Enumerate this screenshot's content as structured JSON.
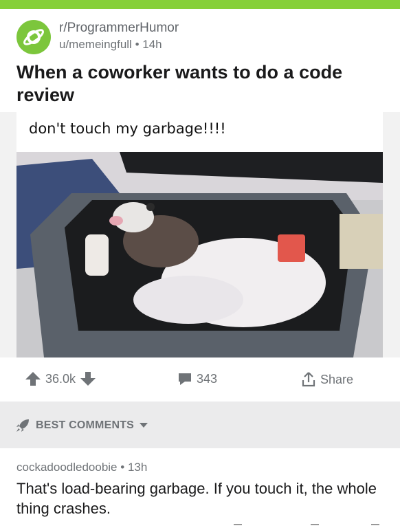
{
  "colors": {
    "accent": "#86d038",
    "avatar": "#7cc63c",
    "meta": "#6f7377"
  },
  "post": {
    "subreddit": "r/ProgrammerHumor",
    "author": "u/memeingfull",
    "time": "14h",
    "title": "When a coworker wants to do a code review",
    "image_caption": "don't touch my garbage!!!!",
    "upvotes": "36.0k",
    "comments": "343",
    "share_label": "Share"
  },
  "icons": [
    "subreddit-planet-icon",
    "upvote-arrow-icon",
    "downvote-arrow-icon",
    "comment-bubble-icon",
    "share-icon",
    "rocket-icon",
    "dropdown-caret-icon"
  ],
  "best_comments": {
    "label": "BEST COMMENTS"
  },
  "comment": {
    "author": "cockadoodledoobie",
    "time": "13h",
    "body": "That's load-bearing garbage. If you touch it, the whole thing crashes."
  }
}
